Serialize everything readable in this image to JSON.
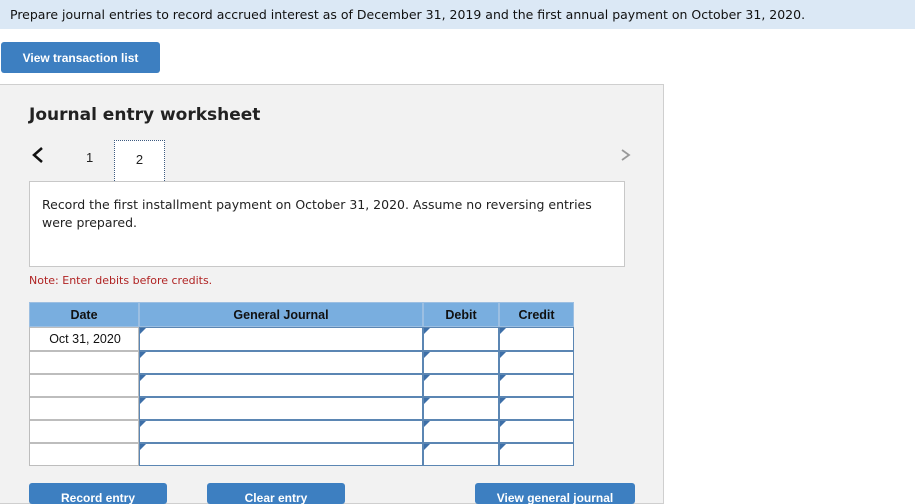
{
  "banner": {
    "text": "Prepare journal entries to record accrued interest as of December 31, 2019 and the first annual payment on October 31, 2020."
  },
  "buttons": {
    "view_transaction_list": "View transaction list",
    "record_entry": "Record entry",
    "clear_entry": "Clear entry",
    "view_general_journal": "View general journal"
  },
  "worksheet": {
    "title": "Journal entry worksheet",
    "pages": [
      "1",
      "2"
    ],
    "current_page": "2",
    "instruction": "Record the first installment payment on October 31, 2020. Assume no reversing entries were prepared.",
    "note": "Note: Enter debits before credits."
  },
  "table": {
    "headers": {
      "date": "Date",
      "journal": "General Journal",
      "debit": "Debit",
      "credit": "Credit"
    },
    "rows": [
      {
        "date": "Oct 31, 2020",
        "journal": "",
        "debit": "",
        "credit": ""
      },
      {
        "date": "",
        "journal": "",
        "debit": "",
        "credit": ""
      },
      {
        "date": "",
        "journal": "",
        "debit": "",
        "credit": ""
      },
      {
        "date": "",
        "journal": "",
        "debit": "",
        "credit": ""
      },
      {
        "date": "",
        "journal": "",
        "debit": "",
        "credit": ""
      },
      {
        "date": "",
        "journal": "",
        "debit": "",
        "credit": ""
      }
    ]
  },
  "icons": {
    "prev": "chevron-left-icon",
    "next": "chevron-right-icon"
  },
  "colors": {
    "button": "#3d7fc1",
    "header": "#79aedf",
    "banner": "#dbe8f5",
    "note": "#b02323"
  }
}
